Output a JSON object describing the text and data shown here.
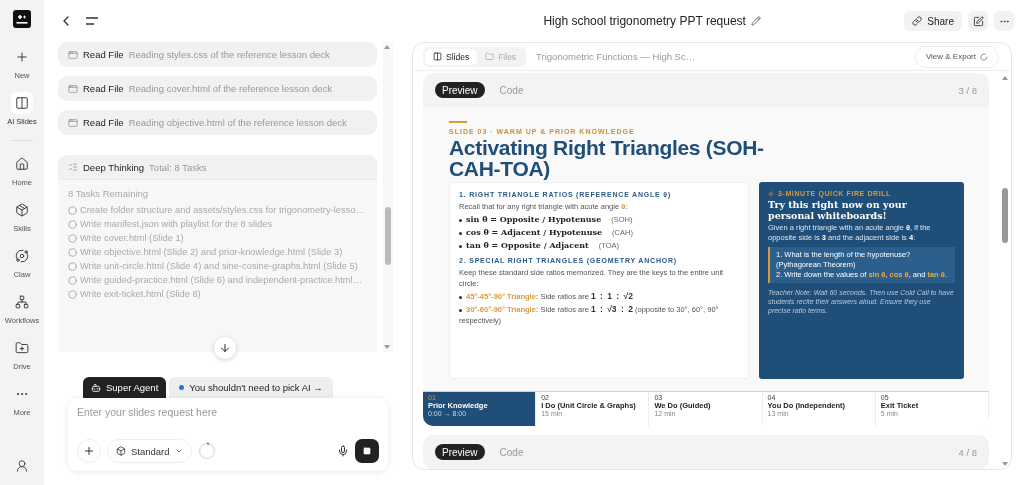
{
  "sidebar": {
    "top_items": [
      {
        "label": "New",
        "selected": false
      },
      {
        "label": "AI Slides",
        "selected": true
      }
    ],
    "nav_items": [
      {
        "label": "Home",
        "selected": false
      },
      {
        "label": "Skills",
        "selected": false
      },
      {
        "label": "Claw",
        "selected": false
      },
      {
        "label": "Workflows",
        "selected": false
      },
      {
        "label": "Drive",
        "selected": false
      },
      {
        "label": "More",
        "selected": false
      }
    ]
  },
  "header": {
    "title": "High school trigonometry PPT request",
    "share_button": "Share"
  },
  "chat": {
    "steps": [
      {
        "action": "Read File",
        "detail": "Reading styles.css of the reference lesson deck"
      },
      {
        "action": "Read File",
        "detail": "Reading cover.html of the reference lesson deck"
      },
      {
        "action": "Read File",
        "detail": "Reading objective.html of the reference lesson deck"
      }
    ],
    "deep_thinking": {
      "title": "Deep Thinking",
      "summary": "Total: 8 Tasks",
      "remaining": "8 Tasks Remaining",
      "tasks": [
        {
          "text": "Create folder structure and assets/styles.css for trigonometry-lesso…",
          "done": false
        },
        {
          "text": "Write manifest.json with playlist for the 8 slides",
          "done": false
        },
        {
          "text": "Write cover.html (Slide 1)",
          "done": false
        },
        {
          "text": "Write objective.html (Slide 2) and prior-knowledge.html (Slide 3)",
          "done": false
        },
        {
          "text": "Write unit-circle.html (Slide 4) and sine-cosine-graphs.html (Slide 5)",
          "done": false
        },
        {
          "text": "Write guided-practice.html (Slide 6) and independent-practice.html…",
          "done": false
        },
        {
          "text": "Write exit-ticket.html (Slide 8)",
          "done": false
        }
      ]
    },
    "composer": {
      "agent_tab": "Super Agent",
      "hint": "You shouldn't need to pick AI →",
      "placeholder": "Enter your slides request here",
      "mode": "Standard"
    }
  },
  "preview": {
    "tabs": [
      {
        "label": "Slides",
        "selected": true
      },
      {
        "label": "Files",
        "selected": false
      }
    ],
    "deck_title": "Trigonometric Functions — High Sc…",
    "export_button": "View & Export",
    "slides": [
      {
        "view_tabs": [
          {
            "label": "Preview",
            "selected": true
          },
          {
            "label": "Code",
            "selected": false
          }
        ],
        "counter": "3 / 8",
        "content": {
          "kicker": "SLIDE 03 · WARM UP & PRIOR KNOWLEDGE",
          "title": "Activating Right Triangles (SOH-CAH-TOA)",
          "ratios": {
            "heading": "1. RIGHT TRIANGLE RATIOS (REFERENCE ANGLE θ)",
            "intro": "Recall that for any right triangle with acute angle **θ**:",
            "items": [
              {
                "formula": "sin θ = Opposite / Hypotenuse",
                "tag": "(SOH)"
              },
              {
                "formula": "cos θ = Adjacent / Hypotenuse",
                "tag": "(CAH)"
              },
              {
                "formula": "tan θ = Opposite / Adjacent",
                "tag": "(TOA)"
              }
            ]
          },
          "special": {
            "heading": "2. SPECIAL RIGHT TRIANGLES (GEOMETRY ANCHOR)",
            "intro": "Keep these standard side ratios memorized. They are the keys to the entire unit circle:",
            "items": [
              {
                "label": "45°-45°-90° Triangle:",
                "text": "Side ratios are",
                "ratio": "1 : 1 : √2"
              },
              {
                "label": "30°-60°-90° Triangle:",
                "text": "Side ratios are",
                "ratio": "1 : √3 : 2",
                "note": "(opposite to 30°, 60°, 90° respectively)"
              }
            ]
          },
          "drill": {
            "kicker": "3-MINUTE QUICK FIRE DRILL",
            "heading": "Try this right now on your personal whiteboards!",
            "prompt": "Given a right triangle with an acute angle **θ**, if the opposite side is **3** and the adjacent side is **4**:",
            "questions": [
              "1. What is the length of the hypotenuse? (Pythagorean Theorem)",
              "2. Write down the values of **sin θ**, **cos θ**, and **tan θ**."
            ],
            "note": "Teacher Note: Wait 60 seconds. Then use Cold Call to have students recite their answers aloud. Ensure they use precise ratio terms."
          },
          "timeline": [
            {
              "number": "01",
              "label": "Prior Knowledge",
              "meta": "0:00 → 8:00",
              "selected": true
            },
            {
              "number": "02",
              "label": "I Do (Unit Circle & Graphs)",
              "meta": "15 min",
              "selected": false
            },
            {
              "number": "03",
              "label": "We Do (Guided)",
              "meta": "12 min",
              "selected": false
            },
            {
              "number": "04",
              "label": "You Do (Independent)",
              "meta": "13 min",
              "selected": false
            },
            {
              "number": "05",
              "label": "Exit Ticket",
              "meta": "5 min",
              "selected": false
            }
          ]
        }
      },
      {
        "view_tabs": [
          {
            "label": "Preview",
            "selected": true
          },
          {
            "label": "Code",
            "selected": false
          }
        ],
        "counter": "4 / 8"
      }
    ]
  }
}
